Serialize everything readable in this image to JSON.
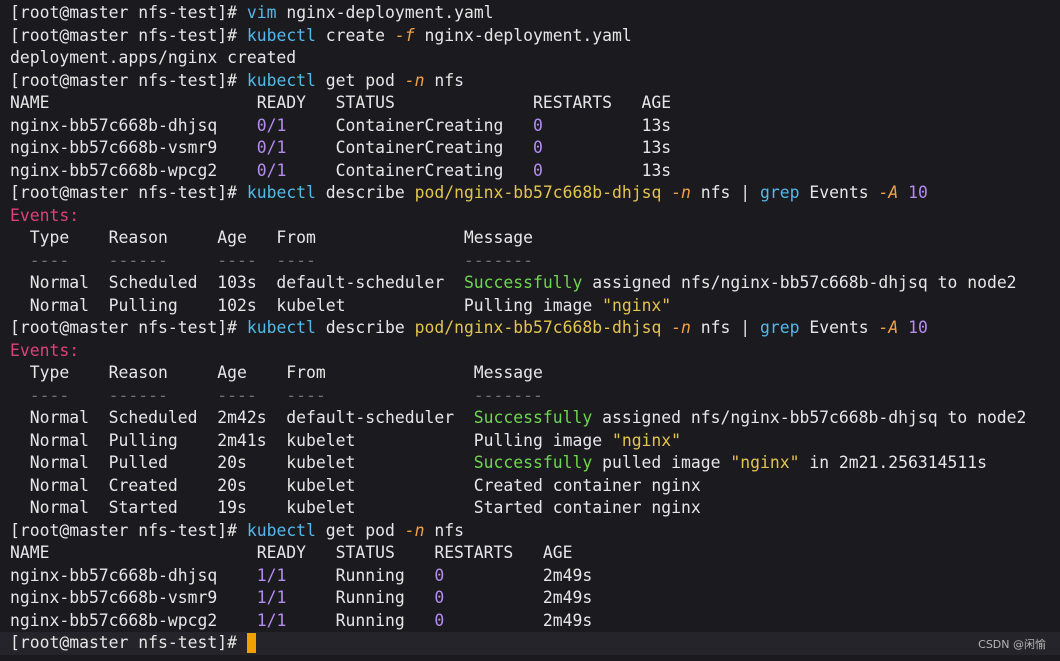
{
  "terminal": {
    "prompt": "[root@master nfs-test]#",
    "cursor_prompt": "[root@master nfs-test]#",
    "watermark": "CSDN @闲愉"
  },
  "lines": [
    [
      {
        "t": "[root@master nfs-test]# ",
        "c": ""
      },
      {
        "t": "vim",
        "c": "cmd"
      },
      {
        "t": " nginx-deployment.yaml",
        "c": ""
      }
    ],
    [
      {
        "t": "[root@master nfs-test]# ",
        "c": ""
      },
      {
        "t": "kubectl",
        "c": "cmd"
      },
      {
        "t": " create ",
        "c": ""
      },
      {
        "t": "-f",
        "c": "flag"
      },
      {
        "t": " nginx-deployment.yaml",
        "c": ""
      }
    ],
    [
      {
        "t": "deployment.apps/nginx created",
        "c": ""
      }
    ],
    [
      {
        "t": "[root@master nfs-test]# ",
        "c": ""
      },
      {
        "t": "kubectl",
        "c": "cmd"
      },
      {
        "t": " get pod ",
        "c": ""
      },
      {
        "t": "-n",
        "c": "flag"
      },
      {
        "t": " nfs",
        "c": ""
      }
    ],
    [
      {
        "t": "NAME                     READY   STATUS              RESTARTS   AGE",
        "c": ""
      }
    ],
    [
      {
        "t": "nginx-bb57c668b-dhjsq    ",
        "c": ""
      },
      {
        "t": "0/1",
        "c": "num"
      },
      {
        "t": "     ContainerCreating   ",
        "c": ""
      },
      {
        "t": "0",
        "c": "num"
      },
      {
        "t": "          13s",
        "c": ""
      }
    ],
    [
      {
        "t": "nginx-bb57c668b-vsmr9    ",
        "c": ""
      },
      {
        "t": "0/1",
        "c": "num"
      },
      {
        "t": "     ContainerCreating   ",
        "c": ""
      },
      {
        "t": "0",
        "c": "num"
      },
      {
        "t": "          13s",
        "c": ""
      }
    ],
    [
      {
        "t": "nginx-bb57c668b-wpcg2    ",
        "c": ""
      },
      {
        "t": "0/1",
        "c": "num"
      },
      {
        "t": "     ContainerCreating   ",
        "c": ""
      },
      {
        "t": "0",
        "c": "num"
      },
      {
        "t": "          13s",
        "c": ""
      }
    ],
    [
      {
        "t": "[root@master nfs-test]# ",
        "c": ""
      },
      {
        "t": "kubectl",
        "c": "cmd"
      },
      {
        "t": " describe ",
        "c": ""
      },
      {
        "t": "pod/nginx-bb57c668b-dhjsq",
        "c": "path"
      },
      {
        "t": " ",
        "c": ""
      },
      {
        "t": "-n",
        "c": "flag"
      },
      {
        "t": " nfs | ",
        "c": ""
      },
      {
        "t": "grep",
        "c": "cmd"
      },
      {
        "t": " Events ",
        "c": ""
      },
      {
        "t": "-A",
        "c": "flag"
      },
      {
        "t": " ",
        "c": ""
      },
      {
        "t": "10",
        "c": "num"
      }
    ],
    [
      {
        "t": "Events:",
        "c": "evt"
      }
    ],
    [
      {
        "t": "  Type    Reason     Age   From               Message",
        "c": ""
      }
    ],
    [
      {
        "t": "  ----    ------     ----  ----               -------",
        "c": "dim"
      }
    ],
    [
      {
        "t": "  Normal  Scheduled  103s  default-scheduler  ",
        "c": ""
      },
      {
        "t": "Successfully",
        "c": "ok"
      },
      {
        "t": " assigned nfs/nginx-bb57c668b-dhjsq to node2",
        "c": ""
      }
    ],
    [
      {
        "t": "  Normal  Pulling    102s  kubelet            Pulling image ",
        "c": ""
      },
      {
        "t": "\"nginx\"",
        "c": "str"
      }
    ],
    [
      {
        "t": "[root@master nfs-test]# ",
        "c": ""
      },
      {
        "t": "kubectl",
        "c": "cmd"
      },
      {
        "t": " describe ",
        "c": ""
      },
      {
        "t": "pod/nginx-bb57c668b-dhjsq",
        "c": "path"
      },
      {
        "t": " ",
        "c": ""
      },
      {
        "t": "-n",
        "c": "flag"
      },
      {
        "t": " nfs | ",
        "c": ""
      },
      {
        "t": "grep",
        "c": "cmd"
      },
      {
        "t": " Events ",
        "c": ""
      },
      {
        "t": "-A",
        "c": "flag"
      },
      {
        "t": " ",
        "c": ""
      },
      {
        "t": "10",
        "c": "num"
      }
    ],
    [
      {
        "t": "Events:",
        "c": "evt"
      }
    ],
    [
      {
        "t": "  Type    Reason     Age    From               Message",
        "c": ""
      }
    ],
    [
      {
        "t": "  ----    ------     ----   ----               -------",
        "c": "dim"
      }
    ],
    [
      {
        "t": "  Normal  Scheduled  2m42s  default-scheduler  ",
        "c": ""
      },
      {
        "t": "Successfully",
        "c": "ok"
      },
      {
        "t": " assigned nfs/nginx-bb57c668b-dhjsq to node2",
        "c": ""
      }
    ],
    [
      {
        "t": "  Normal  Pulling    2m41s  kubelet            Pulling image ",
        "c": ""
      },
      {
        "t": "\"nginx\"",
        "c": "str"
      }
    ],
    [
      {
        "t": "  Normal  Pulled     20s    kubelet            ",
        "c": ""
      },
      {
        "t": "Successfully",
        "c": "ok"
      },
      {
        "t": " pulled image ",
        "c": ""
      },
      {
        "t": "\"nginx\"",
        "c": "str"
      },
      {
        "t": " in 2m21.256314511s",
        "c": ""
      }
    ],
    [
      {
        "t": "  Normal  Created    20s    kubelet            Created container nginx",
        "c": ""
      }
    ],
    [
      {
        "t": "  Normal  Started    19s    kubelet            Started container nginx",
        "c": ""
      }
    ],
    [
      {
        "t": "[root@master nfs-test]# ",
        "c": ""
      },
      {
        "t": "kubectl",
        "c": "cmd"
      },
      {
        "t": " get pod ",
        "c": ""
      },
      {
        "t": "-n",
        "c": "flag"
      },
      {
        "t": " nfs",
        "c": ""
      }
    ],
    [
      {
        "t": "NAME                     READY   STATUS    RESTARTS   AGE",
        "c": ""
      }
    ],
    [
      {
        "t": "nginx-bb57c668b-dhjsq    ",
        "c": ""
      },
      {
        "t": "1/1",
        "c": "num"
      },
      {
        "t": "     Running   ",
        "c": ""
      },
      {
        "t": "0",
        "c": "num"
      },
      {
        "t": "          2m49s",
        "c": ""
      }
    ],
    [
      {
        "t": "nginx-bb57c668b-vsmr9    ",
        "c": ""
      },
      {
        "t": "1/1",
        "c": "num"
      },
      {
        "t": "     Running   ",
        "c": ""
      },
      {
        "t": "0",
        "c": "num"
      },
      {
        "t": "          2m49s",
        "c": ""
      }
    ],
    [
      {
        "t": "nginx-bb57c668b-wpcg2    ",
        "c": ""
      },
      {
        "t": "1/1",
        "c": "num"
      },
      {
        "t": "     Running   ",
        "c": ""
      },
      {
        "t": "0",
        "c": "num"
      },
      {
        "t": "          2m49s",
        "c": ""
      }
    ]
  ],
  "colors": {
    "background": "#1b1b1f",
    "command": "#54b8e8",
    "flag": "#f0a04a",
    "path": "#e3c44e",
    "number": "#b48cf0",
    "events_header": "#e0407a",
    "success": "#6fd64f",
    "cursor": "#f0a000"
  }
}
